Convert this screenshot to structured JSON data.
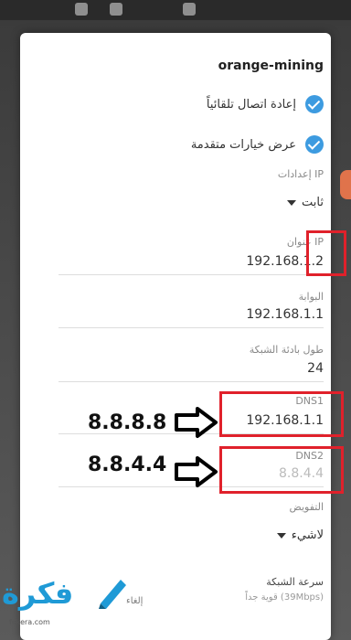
{
  "dialog": {
    "network_name": "orange-mining",
    "auto_reconnect_label": "إعادة اتصال تلقائياً",
    "advanced_options_label": "عرض خيارات متقدمة",
    "ip_settings_label": "إعدادات IP",
    "ip_settings_value": "ثابت",
    "ip_address_label": "عنوان IP",
    "ip_address_value": "192.168.1.2",
    "gateway_label": "البوابة",
    "gateway_value": "192.168.1.1",
    "prefix_label": "طول بادئة الشبكة",
    "prefix_value": "24",
    "dns1_label": "DNS1",
    "dns1_value": "192.168.1.1",
    "dns2_label": "DNS2",
    "dns2_hint": "8.8.4.4",
    "proxy_label": "التفويض",
    "proxy_value": "لاشيء",
    "link_speed_label": "سرعة الشبكة",
    "link_speed_value": "قوية جداً (39Mbps)",
    "cancel_label": "إلغاء"
  },
  "annotations": {
    "dns1_value": "8.8.8.8",
    "dns2_value": "8.8.4.4"
  },
  "watermark": {
    "text": "فكرة",
    "sub": "fekera.com"
  },
  "colors": {
    "check_blue": "#3d9be0",
    "highlight_red": "#e0212b",
    "brand_blue": "#1f9ad6"
  }
}
